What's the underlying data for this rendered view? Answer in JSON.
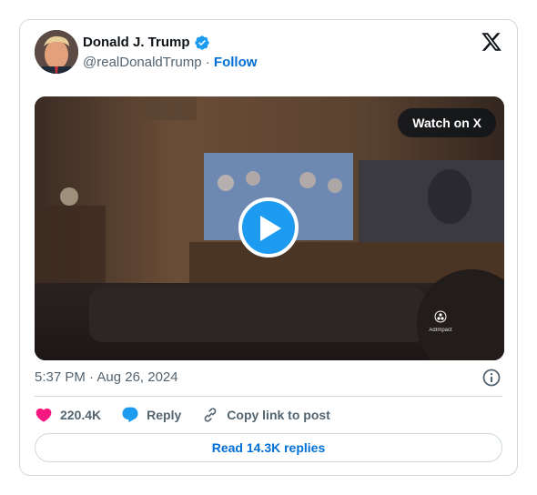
{
  "author": {
    "name": "Donald J. Trump",
    "handle": "@realDonaldTrump",
    "separator": "·",
    "follow_label": "Follow",
    "verified_icon": "verified-badge-icon"
  },
  "media": {
    "watch_label": "Watch on X",
    "watermark_text": "AdImpact"
  },
  "meta": {
    "timestamp": "5:37 PM · Aug 26, 2024"
  },
  "actions": {
    "likes_count": "220.4K",
    "reply_label": "Reply",
    "copy_link_label": "Copy link to post"
  },
  "footer": {
    "read_replies_label": "Read 14.3K replies"
  },
  "colors": {
    "accent": "#1d9bf0",
    "link": "#006fd6",
    "heart": "#f91880",
    "muted": "#536471",
    "border": "#cfd9de"
  }
}
